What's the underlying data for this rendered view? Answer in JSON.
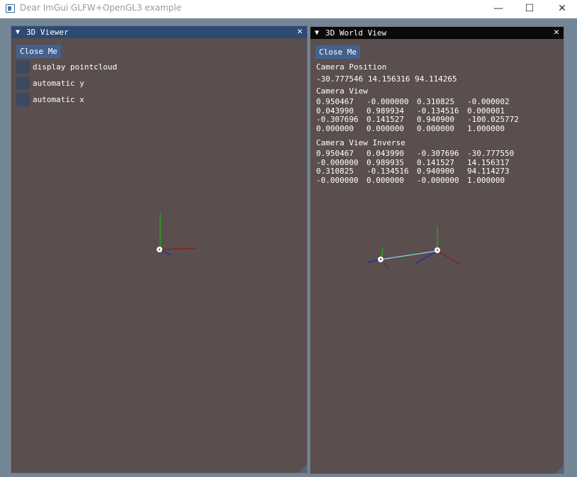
{
  "app": {
    "title": "Dear ImGui GLFW+OpenGL3 example",
    "min_glyph": "—",
    "max_glyph": "☐",
    "close_glyph": "✕"
  },
  "viewer": {
    "collapse_glyph": "▼",
    "title": "3D Viewer",
    "close_glyph": "✕",
    "close_me": "Close Me",
    "checkboxes": [
      {
        "label": "display pointcloud",
        "checked": false
      },
      {
        "label": "automatic y",
        "checked": false
      },
      {
        "label": "automatic x",
        "checked": false
      }
    ]
  },
  "world": {
    "collapse_glyph": "▼",
    "title": "3D World View",
    "close_glyph": "✕",
    "close_me": "Close Me",
    "camera_position_label": "Camera Position",
    "camera_position_value": "-30.777546 14.156316 94.114265",
    "camera_view_label": "Camera View",
    "camera_view": [
      [
        "0.950467",
        "-0.000000",
        "0.310825",
        "-0.000002"
      ],
      [
        "0.043990",
        "0.989934",
        "-0.134516",
        "0.000001"
      ],
      [
        "-0.307696",
        "0.141527",
        "0.940900",
        "-100.025772"
      ],
      [
        "0.000000",
        "0.000000",
        "0.000000",
        "1.000000"
      ]
    ],
    "camera_view_inverse_label": "Camera View Inverse",
    "camera_view_inverse": [
      [
        "0.950467",
        "0.043990",
        "-0.307696",
        "-30.777550"
      ],
      [
        "-0.000000",
        "0.989935",
        "0.141527",
        "14.156317"
      ],
      [
        "0.310825",
        "-0.134516",
        "0.940900",
        "94.114273"
      ],
      [
        "-0.000000",
        "0.000000",
        "-0.000000",
        "1.000000"
      ]
    ]
  },
  "colors": {
    "background": "#728696",
    "window_bg": "#5a4e4e",
    "title_active": "#2c4a74",
    "title_inactive": "#0a0a0a",
    "button": "#43628e",
    "checkbox": "#3b4a63",
    "axis_x": "#8b1a1a",
    "axis_y": "#1eb41e",
    "axis_z": "#2222bb",
    "camera_link": "#8fd0e8"
  }
}
